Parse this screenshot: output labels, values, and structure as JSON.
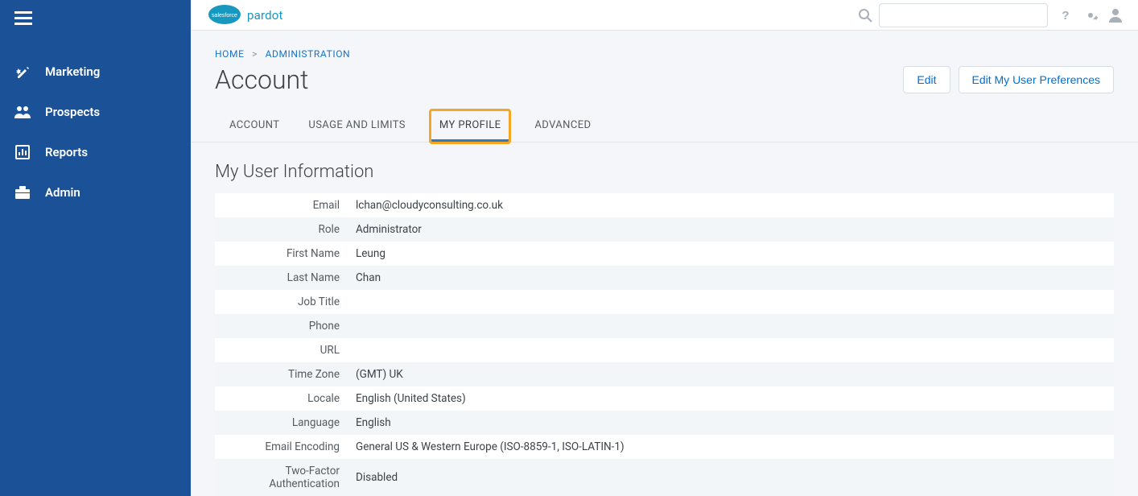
{
  "brand": {
    "name": "pardot",
    "cloud_label": "salesforce"
  },
  "nav": {
    "items": [
      {
        "label": "Marketing"
      },
      {
        "label": "Prospects"
      },
      {
        "label": "Reports"
      },
      {
        "label": "Admin"
      }
    ]
  },
  "breadcrumb": {
    "home": "HOME",
    "sep": ">",
    "section": "ADMINISTRATION"
  },
  "page": {
    "title": "Account"
  },
  "actions": {
    "edit": "Edit",
    "edit_prefs": "Edit My User Preferences"
  },
  "tabs": {
    "account": "ACCOUNT",
    "usage": "USAGE AND LIMITS",
    "my_profile": "MY PROFILE",
    "advanced": "ADVANCED"
  },
  "section": {
    "title": "My User Information"
  },
  "fields": {
    "email": {
      "label": "Email",
      "value": "lchan@cloudyconsulting.co.uk"
    },
    "role": {
      "label": "Role",
      "value": "Administrator"
    },
    "first_name": {
      "label": "First Name",
      "value": "Leung"
    },
    "last_name": {
      "label": "Last Name",
      "value": "Chan"
    },
    "job_title": {
      "label": "Job Title",
      "value": ""
    },
    "phone": {
      "label": "Phone",
      "value": ""
    },
    "url": {
      "label": "URL",
      "value": ""
    },
    "time_zone": {
      "label": "Time Zone",
      "value": "(GMT) UK"
    },
    "locale": {
      "label": "Locale",
      "value": "English (United States)"
    },
    "language": {
      "label": "Language",
      "value": "English"
    },
    "encoding": {
      "label": "Email Encoding",
      "value": "General US & Western Europe (ISO-8859-1, ISO-LATIN-1)"
    },
    "two_factor": {
      "label": "Two-Factor Authentication",
      "value": "Disabled"
    }
  }
}
